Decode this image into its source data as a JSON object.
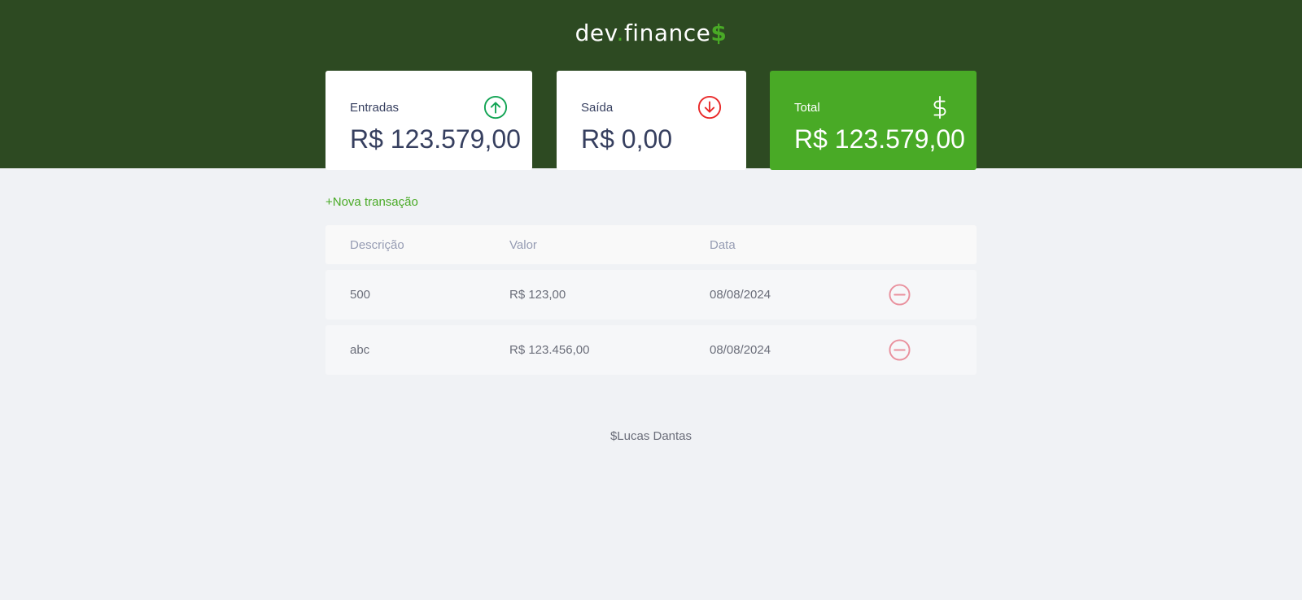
{
  "header": {
    "logo": {
      "part1": "dev",
      "dot": ".",
      "part2": "finance",
      "dollar": "$"
    }
  },
  "cards": {
    "income": {
      "title": "Entradas",
      "value": "R$ 123.579,00",
      "icon": "arrow-up-circle-icon"
    },
    "expense": {
      "title": "Saída",
      "value": "R$ 0,00",
      "icon": "arrow-down-circle-icon"
    },
    "total": {
      "title": "Total",
      "value": "R$ 123.579,00",
      "icon": "dollar-sign-icon"
    }
  },
  "actions": {
    "new_transaction": "+Nova transação"
  },
  "table": {
    "headers": [
      "Descrição",
      "Valor",
      "Data",
      ""
    ],
    "rows": [
      {
        "description": "500",
        "value": "R$ 123,00",
        "date": "08/08/2024",
        "action_icon": "minus-circle-icon"
      },
      {
        "description": "abc",
        "value": "R$ 123.456,00",
        "date": "08/08/2024",
        "action_icon": "minus-circle-icon"
      }
    ]
  },
  "footer": {
    "text": "$Lucas Dantas"
  },
  "colors": {
    "header_bg": "#2d4a22",
    "accent": "#49aa26",
    "income_icon": "#12a454",
    "expense_icon": "#e92929",
    "text_dark": "#363f5f",
    "page_bg": "#f0f2f5"
  }
}
